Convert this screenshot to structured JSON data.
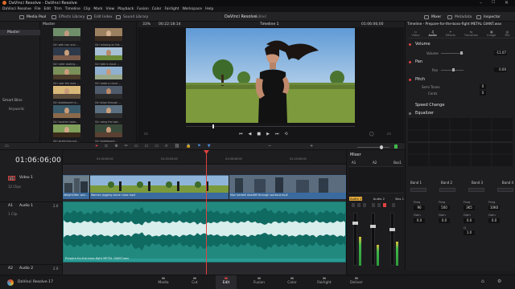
{
  "titlebar": {
    "title": "DaVinci Resolve - DaVinci Resolve"
  },
  "menu": [
    "DaVinci Resolve",
    "File",
    "Edit",
    "Trim",
    "Timeline",
    "Clip",
    "Mark",
    "View",
    "Playback",
    "Fusion",
    "Color",
    "Fairlight",
    "Workspace",
    "Help"
  ],
  "toolbar": {
    "media_pool": "Media Pool",
    "effects_library": "Effects Library",
    "edit_index": "Edit Index",
    "sound_library": "Sound Library",
    "app_name": "DaVinci Resolve",
    "edited": "Edited",
    "mixer": "Mixer",
    "metadata": "Metadata",
    "inspector": "Inspector"
  },
  "media_pool": {
    "master_header": "Master",
    "bin_master": "Master",
    "smart_bins": "Smart Bins",
    "keywords": "Keywords",
    "clips": [
      {
        "label": "Girl with hair and ..."
      },
      {
        "label": "Girl relaxing on the ..."
      },
      {
        "label": "Girl roller skating ..."
      },
      {
        "label": "Girl take a cloud ..."
      },
      {
        "label": "Girl near the road ..."
      },
      {
        "label": "Girl make a cloud ..."
      },
      {
        "label": "Girl skateboard ro..."
      },
      {
        "label": "Girl skips through ..."
      },
      {
        "label": "Girl touches lapto..."
      },
      {
        "label": "Girl using the lapt..."
      },
      {
        "label": "Girl stretching out..."
      },
      {
        "label": "Girl skateboard ..."
      }
    ]
  },
  "viewer": {
    "zoom": "33%",
    "source_tc": "00:22:18:14",
    "timeline_name": "Timeline 1",
    "record_tc": "01:06:06;00"
  },
  "inspector": {
    "title": "Timeline - Prepare-for-the-boss-fight METAL GIANT.wav",
    "tabs": [
      "Video",
      "Audio",
      "Effects",
      "Transition",
      "Image",
      "File"
    ],
    "volume_header": "Volume",
    "volume_label": "Volume",
    "volume_value": "-11.07",
    "pan_header": "Pan",
    "pan_label": "Pan",
    "pan_value": "0.00",
    "pitch_header": "Pitch",
    "semi_tones_label": "Semi Tones",
    "semi_tones_value": "0",
    "cents_label": "Cents",
    "cents_value": "0",
    "speed_change": "Speed Change",
    "equalizer": "Equalizer",
    "bands": [
      "Band 1",
      "Band 2",
      "Band 3",
      "Band 4"
    ],
    "freq_label": "Freq",
    "freq_values": [
      "90",
      "500",
      "3K5",
      "10K0"
    ],
    "gain_label": "Gain",
    "gain_values": [
      "0.0",
      "0.0",
      "0.0",
      "0.0"
    ],
    "q_label": "Q",
    "q_value": "1.0"
  },
  "timeline": {
    "timecode": "01:06:06;00",
    "ruler": [
      "01:00:00;00",
      "01:03:20;00",
      "01:06:40;00",
      "01:10:00;00",
      "01:13:20;00"
    ],
    "video_track": {
      "tag": "V1",
      "name": "Video 1",
      "clips": "12 Clips"
    },
    "audio_track": {
      "tag": "A1",
      "name": "Audio 1",
      "value": "2.0",
      "clips": "1 Clip"
    },
    "audio_track2": {
      "tag": "A2",
      "name": "Audio 2",
      "value": "2.0"
    },
    "video_clip_labels": [
      "Weightlifter wor...",
      "Woman jogging alone close.mp4",
      "Man barbell deadlift through workout.mp4"
    ],
    "audio_clip_label": "Prepare-for-the-boss-fight METAL GIANT.wav"
  },
  "mixer": {
    "title": "Mixer",
    "channels": [
      "A1",
      "A2",
      "Bus1"
    ],
    "strip_labels": [
      "Audio 1",
      "Audio 2",
      "Bus 1"
    ],
    "levels": [
      0.55,
      0.4,
      0.45
    ]
  },
  "pages": [
    "Media",
    "Cut",
    "Edit",
    "Fusion",
    "Color",
    "Fairlight",
    "Deliver"
  ],
  "active_page": "Edit",
  "status": "DaVinci Resolve 17",
  "colors": {
    "accent": "#e0423f",
    "video_clip": "#3a6a9e",
    "audio_clip": "#2a9b94",
    "playhead": "#e0423f"
  }
}
